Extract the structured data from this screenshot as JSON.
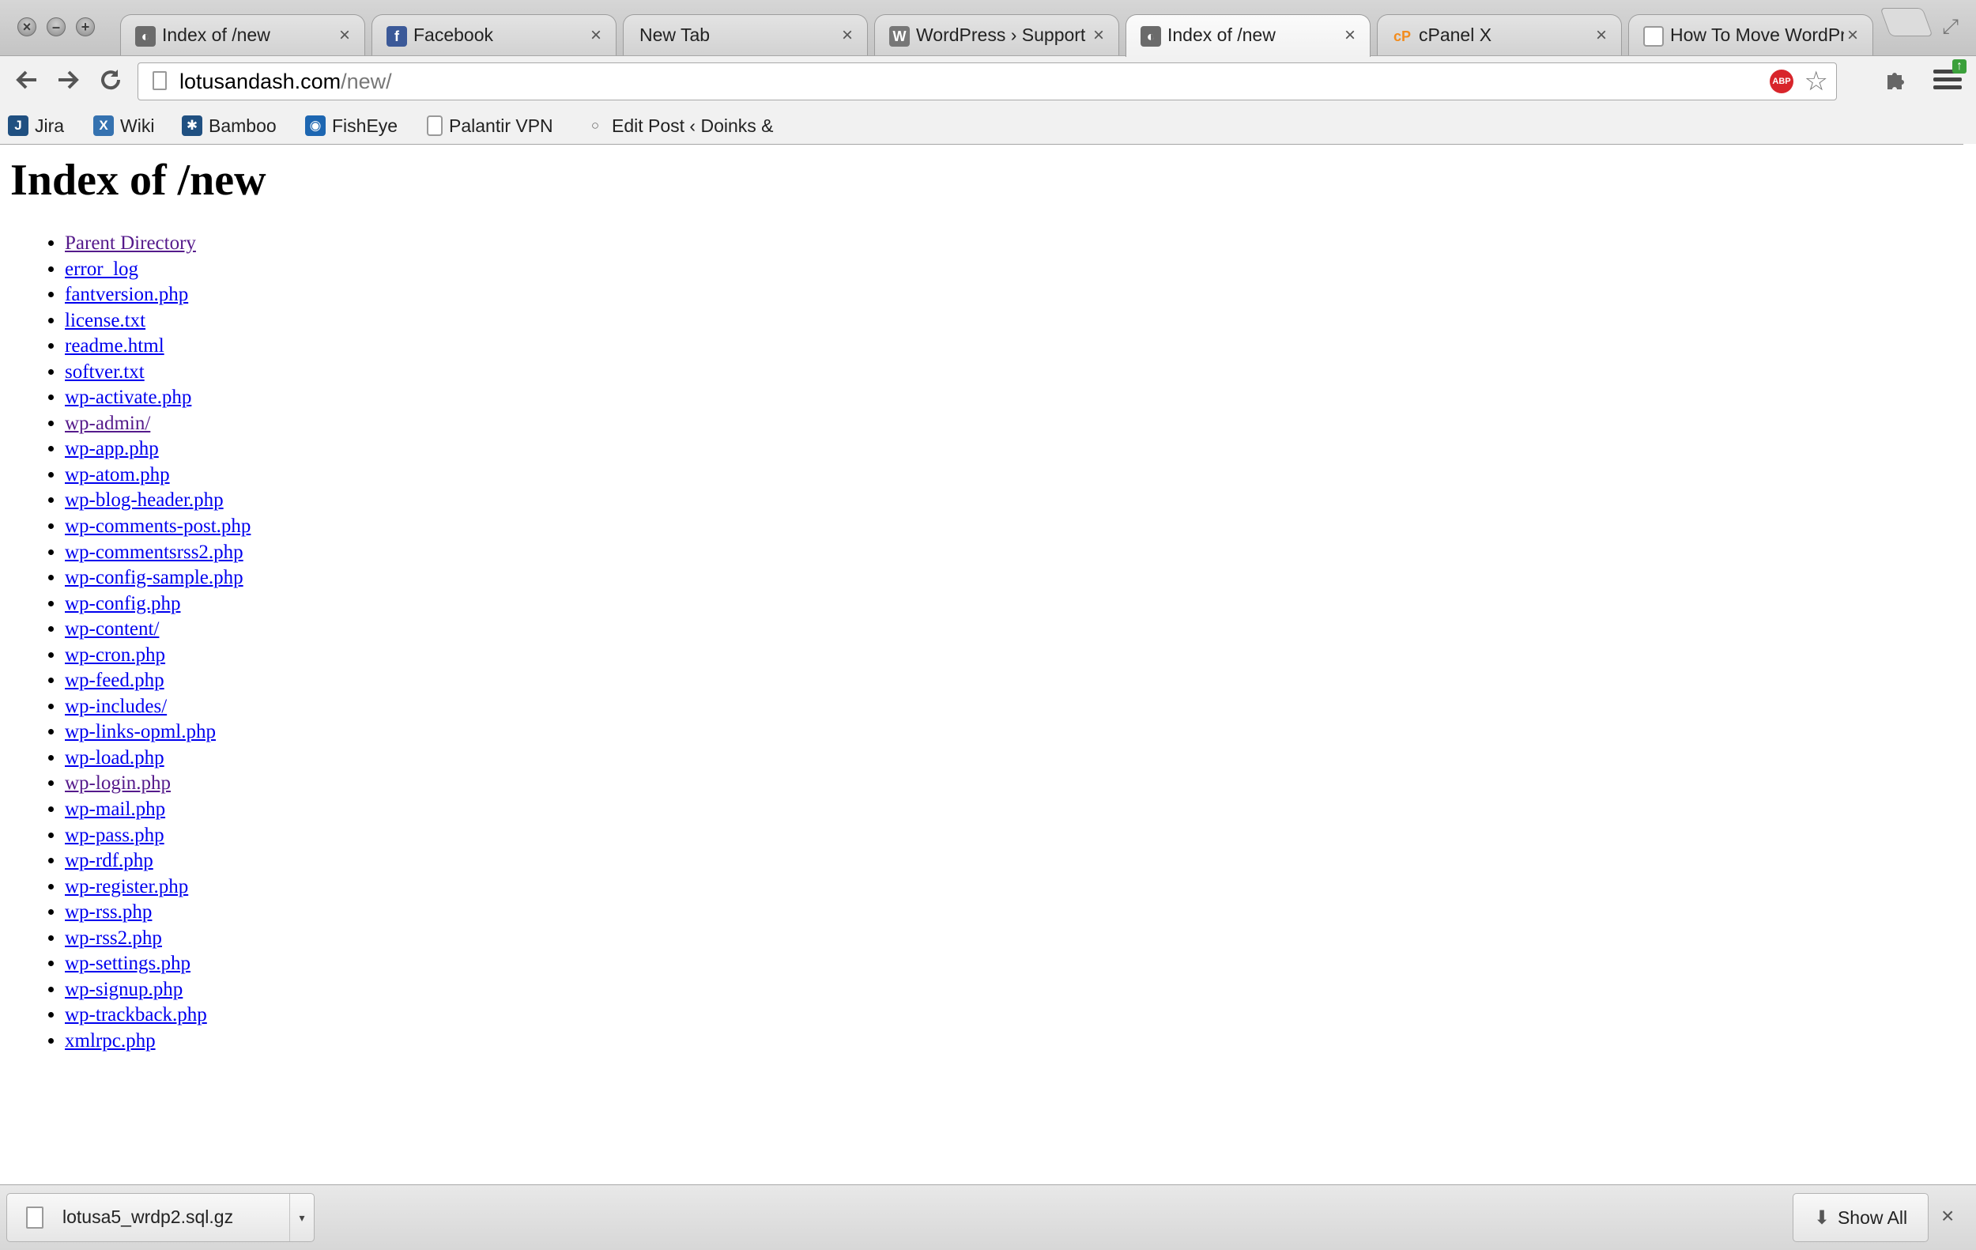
{
  "tabs": [
    {
      "title": "Index of /new",
      "icon": "index-favicon-icon",
      "active": false
    },
    {
      "title": "Facebook",
      "icon": "facebook-favicon-icon",
      "active": false
    },
    {
      "title": "New Tab",
      "icon": "",
      "active": false
    },
    {
      "title": "WordPress › Support »",
      "icon": "wordpress-favicon-icon",
      "active": false
    },
    {
      "title": "Index of /new",
      "icon": "index-favicon-icon",
      "active": true
    },
    {
      "title": "cPanel X",
      "icon": "cpanel-favicon-icon",
      "active": false
    },
    {
      "title": "How To Move WordPre",
      "icon": "page-favicon-icon",
      "active": false
    }
  ],
  "tab_close_glyph": "×",
  "address": {
    "host": "lotusandash.com",
    "path": "/new/"
  },
  "bookmarks": [
    {
      "label": "Jira",
      "icon": "jira-icon"
    },
    {
      "label": "Wiki",
      "icon": "wiki-icon"
    },
    {
      "label": "Bamboo",
      "icon": "bamboo-icon"
    },
    {
      "label": "FishEye",
      "icon": "fisheye-icon"
    },
    {
      "label": "Palantir VPN",
      "icon": "page-icon"
    },
    {
      "label": "Edit Post ‹ Doinks &",
      "icon": "globe-icon"
    }
  ],
  "page": {
    "heading": "Index of /new",
    "links": [
      {
        "text": "Parent Directory",
        "visited": true
      },
      {
        "text": "error_log",
        "visited": false
      },
      {
        "text": "fantversion.php",
        "visited": false
      },
      {
        "text": "license.txt",
        "visited": false
      },
      {
        "text": "readme.html",
        "visited": false
      },
      {
        "text": "softver.txt",
        "visited": false
      },
      {
        "text": "wp-activate.php",
        "visited": false
      },
      {
        "text": "wp-admin/",
        "visited": true
      },
      {
        "text": "wp-app.php",
        "visited": false
      },
      {
        "text": "wp-atom.php",
        "visited": false
      },
      {
        "text": "wp-blog-header.php",
        "visited": false
      },
      {
        "text": "wp-comments-post.php",
        "visited": false
      },
      {
        "text": "wp-commentsrss2.php",
        "visited": false
      },
      {
        "text": "wp-config-sample.php",
        "visited": false
      },
      {
        "text": "wp-config.php",
        "visited": false
      },
      {
        "text": "wp-content/",
        "visited": false
      },
      {
        "text": "wp-cron.php",
        "visited": false
      },
      {
        "text": "wp-feed.php",
        "visited": false
      },
      {
        "text": "wp-includes/",
        "visited": false
      },
      {
        "text": "wp-links-opml.php",
        "visited": false
      },
      {
        "text": "wp-load.php",
        "visited": false
      },
      {
        "text": "wp-login.php",
        "visited": true
      },
      {
        "text": "wp-mail.php",
        "visited": false
      },
      {
        "text": "wp-pass.php",
        "visited": false
      },
      {
        "text": "wp-rdf.php",
        "visited": false
      },
      {
        "text": "wp-register.php",
        "visited": false
      },
      {
        "text": "wp-rss.php",
        "visited": false
      },
      {
        "text": "wp-rss2.php",
        "visited": false
      },
      {
        "text": "wp-settings.php",
        "visited": false
      },
      {
        "text": "wp-signup.php",
        "visited": false
      },
      {
        "text": "wp-trackback.php",
        "visited": false
      },
      {
        "text": "xmlrpc.php",
        "visited": false
      }
    ]
  },
  "download_shelf": {
    "file_name": "lotusa5_wrdp2.sql.gz",
    "show_all_label": "Show All"
  },
  "colors": {
    "link": "#0000ee",
    "visited_link": "#551a8b",
    "abp": "#d8252b",
    "facebook": "#3b5998",
    "cpanel": "#f28c1e"
  }
}
